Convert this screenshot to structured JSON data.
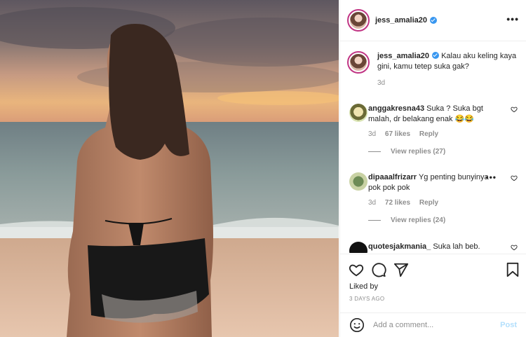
{
  "post": {
    "username": "jess_amalia20",
    "more_icon": "more-horizontal-icon",
    "caption": "Kalau aku keling kaya gini, kamu tetep suka gak?",
    "caption_time": "3d"
  },
  "comments": [
    {
      "username": "anggakresna43",
      "text": "Suka ? Suka bgt malah, dr belakang enak 😂😂",
      "time": "3d",
      "likes": "67 likes",
      "reply": "Reply",
      "view_replies": "View replies (27)"
    },
    {
      "username": "dipaaalfrizarr",
      "text": "Yg penting bunyinya pok pok pok",
      "time": "3d",
      "likes": "72 likes",
      "reply": "Reply",
      "view_replies": "View replies (24)"
    },
    {
      "username": "quotesjakmania_",
      "text": "Suka lah beb."
    }
  ],
  "actions": {
    "liked_by": "Liked by",
    "timestamp": "3 DAYS AGO",
    "icons": [
      "heart-icon",
      "comment-icon",
      "share-icon",
      "bookmark-icon"
    ]
  },
  "add_comment": {
    "placeholder": "Add a comment...",
    "post_label": "Post"
  },
  "colors": {
    "verified": "#3897f0",
    "muted": "#8e8e8e",
    "post_disabled": "#b2dffc"
  }
}
